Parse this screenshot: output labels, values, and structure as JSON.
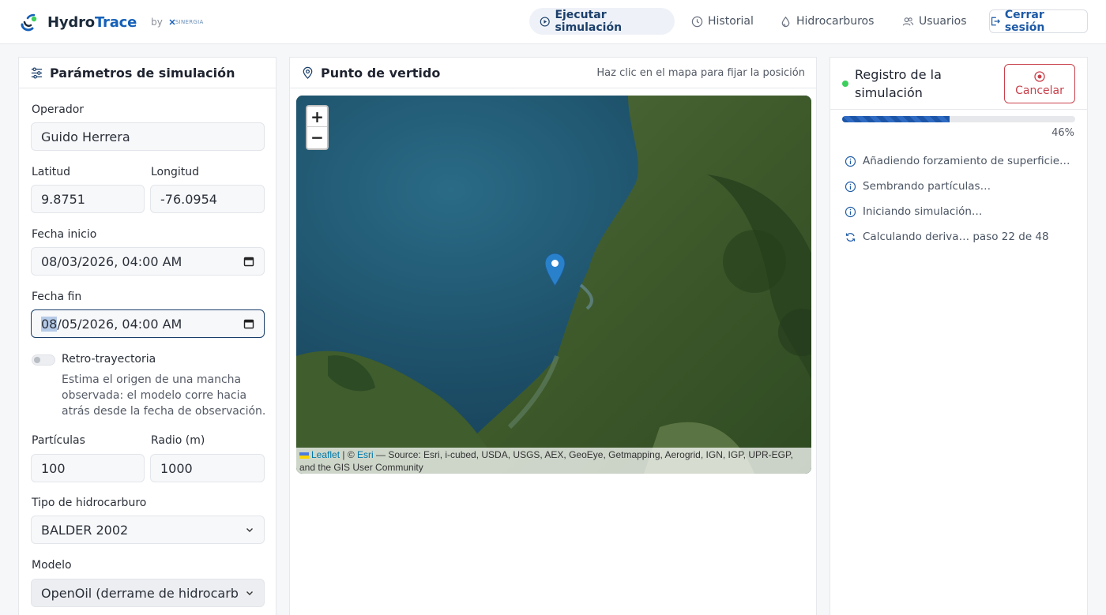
{
  "app": {
    "name_part1": "Hydro",
    "name_part2": "Trace",
    "by": "by",
    "partner": "SINERGIA"
  },
  "nav": {
    "run": "Ejecutar simulación",
    "history": "Historial",
    "hydrocarbons": "Hidrocarburos",
    "users": "Usuarios",
    "logout": "Cerrar sesión"
  },
  "params": {
    "title": "Parámetros de simulación",
    "operator_label": "Operador",
    "operator_value": "Guido Herrera",
    "lat_label": "Latitud",
    "lat_value": "9.8751",
    "lon_label": "Longitud",
    "lon_value": "-76.0954",
    "start_label": "Fecha inicio",
    "start_value": "08/03/2026, 04:00  AM",
    "end_label": "Fecha fin",
    "end_value_selected": "08",
    "end_value_rest": "/05/2026, 04:00  AM",
    "retro_label": "Retro-trayectoria",
    "retro_help": "Estima el origen de una mancha observada: el modelo corre hacia atrás desde la fecha de observación.",
    "particles_label": "Partículas",
    "particles_value": "100",
    "radius_label": "Radio (m)",
    "radius_value": "1000",
    "hydro_type_label": "Tipo de hidrocarburo",
    "hydro_type_value": "BALDER 2002",
    "model_label": "Modelo",
    "model_value": "OpenOil (derrame de hidrocarburos)"
  },
  "map": {
    "title": "Punto de vertido",
    "hint": "Haz clic en el mapa para fijar la posición",
    "zoom_in": "+",
    "zoom_out": "−",
    "attrib_leaflet": "Leaflet",
    "attrib_sep": " | © ",
    "attrib_esri": "Esri",
    "attrib_source": " — Source: Esri, i-cubed, USDA, USGS, AEX, GeoEye, Getmapping, Aerogrid, IGN, IGP, UPR-EGP, and the GIS User Community"
  },
  "log": {
    "title": "Registro de la simulación",
    "cancel": "Cancelar",
    "progress": 0.46,
    "progress_label": "46%",
    "items": [
      {
        "text": "Añadiendo forzamiento de superficie…",
        "icon": "info-icon"
      },
      {
        "text": "Sembrando partículas…",
        "icon": "info-icon"
      },
      {
        "text": "Iniciando simulación…",
        "icon": "info-icon"
      },
      {
        "text": "Calculando deriva… paso 22 de 48",
        "icon": "refresh-icon"
      }
    ]
  },
  "colors": {
    "brand_blue": "#1560b8",
    "nav_active_bg": "#eef2f8",
    "cancel_red": "#c8414b",
    "status_green": "#3ccf5b",
    "progress_blue": "#1d56a8"
  }
}
